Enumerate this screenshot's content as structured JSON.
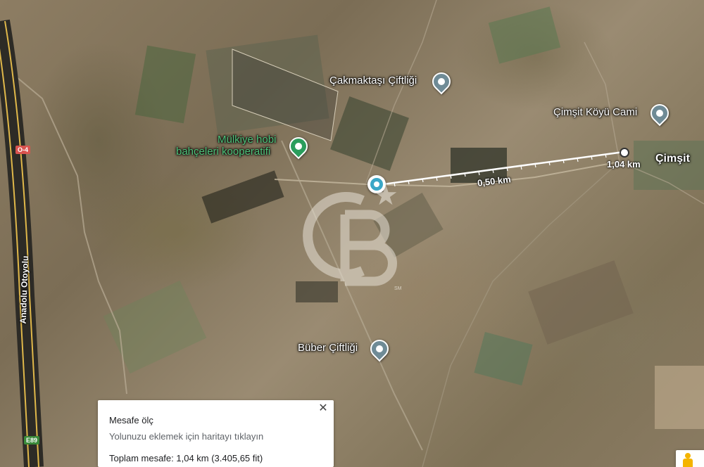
{
  "map": {
    "type": "satellite",
    "highway": {
      "name": "Anadolu Otoyolu",
      "shields": [
        "O-4",
        "E89"
      ]
    },
    "places": [
      {
        "name": "Çakmaktaşı Çiftliği",
        "icon": "farm-pin-icon",
        "color": "#6f8b96"
      },
      {
        "name": "Çimşit Köyü Cami",
        "icon": "mosque-pin-icon",
        "color": "#6f8b96"
      },
      {
        "name": "Çimşit",
        "icon": "",
        "color": "#ffffff"
      },
      {
        "name": "Mülkiye hobi",
        "icon": "park-pin-icon",
        "color": "#2a9d5c"
      },
      {
        "name": "bahçeleri kooperatifi",
        "icon": "",
        "color": "#2a9d5c"
      },
      {
        "name": "Büber Çiftliği",
        "icon": "farm-pin-icon",
        "color": "#6f8b96"
      }
    ],
    "measure_line": {
      "start_marker": "selected-location-pin-icon",
      "end_marker": "measure-point-icon",
      "labels": [
        "0,50 km",
        "1,04 km"
      ],
      "color": "#ffffff"
    },
    "watermark": {
      "text": "CB",
      "mark": "SM"
    }
  },
  "measure_panel": {
    "title": "Mesafe ölç",
    "hint": "Yolunuzu eklemek için haritayı tıklayın",
    "total": "Toplam mesafe: 1,04 km (3.405,65 fit)",
    "close_icon": "close-icon"
  },
  "pegman": {
    "icon": "pegman-icon"
  }
}
